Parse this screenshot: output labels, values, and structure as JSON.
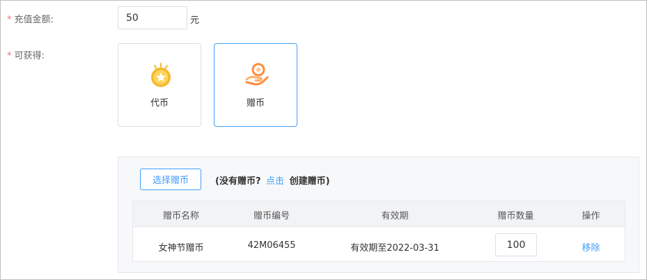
{
  "form": {
    "amount_label": "充值金额:",
    "amount_value": "50",
    "amount_unit": "元",
    "obtain_label": "可获得:",
    "required_mark": "*"
  },
  "options": [
    {
      "label": "代币",
      "icon": "gold-medal-icon",
      "selected": false
    },
    {
      "label": "赠币",
      "icon": "coin-hand-icon",
      "selected": true
    }
  ],
  "gift_panel": {
    "select_button": "选择赠币",
    "hint_prefix": "(没有赠币?",
    "hint_link": "点击",
    "hint_suffix": "创建赠币)"
  },
  "table": {
    "headers": [
      "赠币名称",
      "赠币编号",
      "有效期",
      "赠币数量",
      "操作"
    ],
    "rows": [
      {
        "name": "女神节赠币",
        "code": "42M06455",
        "validity": "有效期至2022-03-31",
        "quantity": "100",
        "action": "移除"
      }
    ]
  },
  "colors": {
    "accent": "#409eff",
    "required": "#f56c6c",
    "icon_gold": "#f5b82e",
    "icon_orange": "#ff8a3d"
  }
}
